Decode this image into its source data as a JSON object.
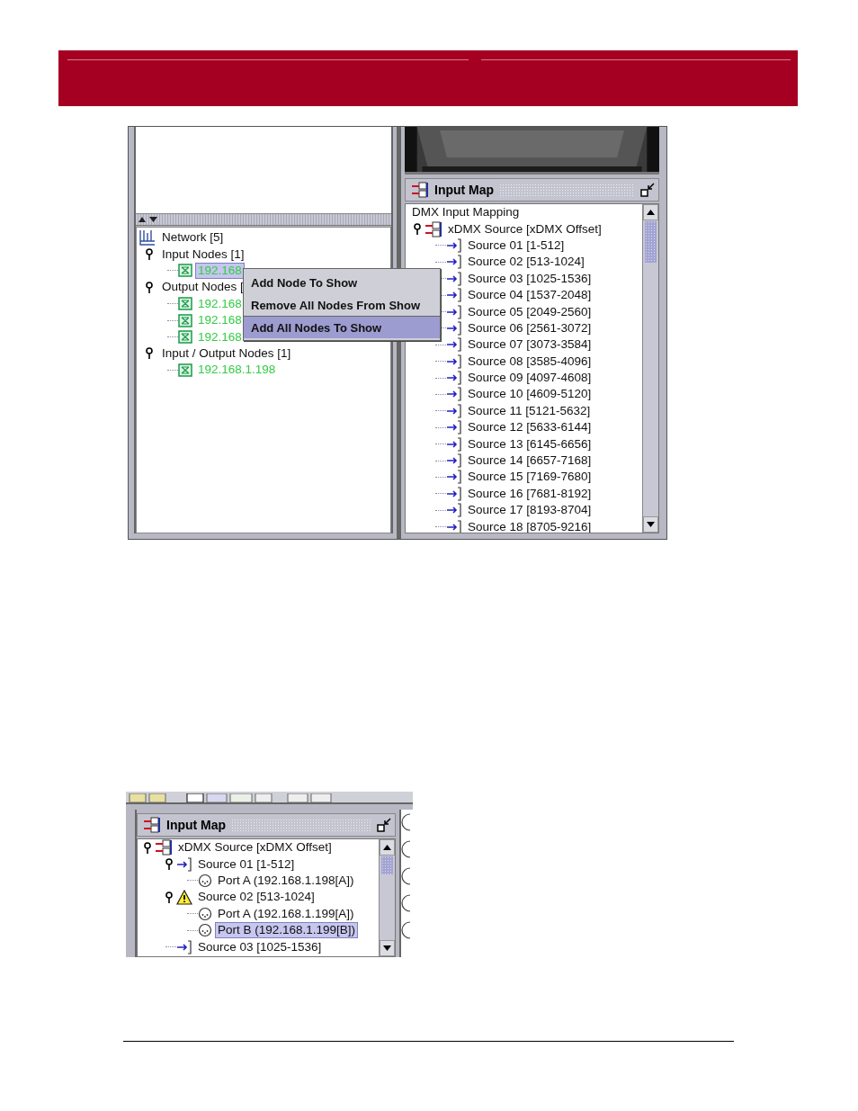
{
  "screenshot_1": {
    "network_tree": [
      {
        "label": "Network [5]",
        "kind": "root",
        "selected": false,
        "children": [
          {
            "label": "Input Nodes [1]",
            "selected": false,
            "children": [
              {
                "label": "192.168",
                "kind": "node",
                "selected": true
              }
            ]
          },
          {
            "label": "Output Nodes [",
            "selected": false,
            "children": [
              {
                "label": "192.168",
                "kind": "node",
                "selected": false
              },
              {
                "label": "192.168",
                "kind": "node",
                "selected": false
              },
              {
                "label": "192.168",
                "kind": "node",
                "selected": false
              }
            ]
          },
          {
            "label": "Input / Output Nodes [1]",
            "selected": false,
            "children": [
              {
                "label": "192.168.1.198",
                "kind": "node",
                "selected": false
              }
            ]
          }
        ]
      }
    ],
    "context_menu": [
      {
        "label": "Add Node To Show",
        "selected": false
      },
      {
        "label": "Remove All Nodes From Show",
        "selected": false
      },
      {
        "label": "Add All Nodes To Show",
        "selected": true
      }
    ],
    "input_map": {
      "title": "Input Map",
      "tree": [
        {
          "label": "DMX Input Mapping",
          "kind": "heading",
          "selected": false,
          "children": [
            {
              "label": "xDMX Source [xDMX Offset]",
              "kind": "map",
              "selected": false,
              "children": [
                {
                  "label": "Source 01 [1-512]",
                  "kind": "source",
                  "selected": false
                },
                {
                  "label": "Source 02 [513-1024]",
                  "kind": "source",
                  "selected": false
                },
                {
                  "label": "Source 03 [1025-1536]",
                  "kind": "source",
                  "selected": false
                },
                {
                  "label": "Source 04 [1537-2048]",
                  "kind": "source",
                  "selected": false
                },
                {
                  "label": "Source 05 [2049-2560]",
                  "kind": "source",
                  "selected": false
                },
                {
                  "label": "Source 06 [2561-3072]",
                  "kind": "source",
                  "selected": false
                },
                {
                  "label": "Source 07 [3073-3584]",
                  "kind": "source",
                  "selected": false
                },
                {
                  "label": "Source 08 [3585-4096]",
                  "kind": "source",
                  "selected": false
                },
                {
                  "label": "Source 09 [4097-4608]",
                  "kind": "source",
                  "selected": false
                },
                {
                  "label": "Source 10 [4609-5120]",
                  "kind": "source",
                  "selected": false
                },
                {
                  "label": "Source 11 [5121-5632]",
                  "kind": "source",
                  "selected": false
                },
                {
                  "label": "Source 12 [5633-6144]",
                  "kind": "source",
                  "selected": false
                },
                {
                  "label": "Source 13 [6145-6656]",
                  "kind": "source",
                  "selected": false
                },
                {
                  "label": "Source 14 [6657-7168]",
                  "kind": "source",
                  "selected": false
                },
                {
                  "label": "Source 15 [7169-7680]",
                  "kind": "source",
                  "selected": false
                },
                {
                  "label": "Source 16 [7681-8192]",
                  "kind": "source",
                  "selected": false
                },
                {
                  "label": "Source 17 [8193-8704]",
                  "kind": "source",
                  "selected": false
                },
                {
                  "label": "Source 18 [8705-9216]",
                  "kind": "source",
                  "selected": false
                }
              ]
            }
          ]
        }
      ]
    }
  },
  "screenshot_2": {
    "input_map": {
      "title": "Input Map",
      "tree": [
        {
          "label": "xDMX Source [xDMX Offset]",
          "kind": "map",
          "selected": false,
          "children": [
            {
              "label": "Source 01 [1-512]",
              "kind": "source",
              "selected": false,
              "children": [
                {
                  "label": "Port A (192.168.1.198[A])",
                  "kind": "port",
                  "selected": false
                }
              ]
            },
            {
              "label": "Source 02 [513-1024]",
              "kind": "warning",
              "selected": false,
              "children": [
                {
                  "label": "Port A (192.168.1.199[A])",
                  "kind": "port",
                  "selected": false
                },
                {
                  "label": "Port B (192.168.1.199[B])",
                  "kind": "port",
                  "selected": true
                }
              ]
            },
            {
              "label": "Source 03 [1025-1536]",
              "kind": "source",
              "selected": false
            }
          ]
        }
      ]
    }
  }
}
